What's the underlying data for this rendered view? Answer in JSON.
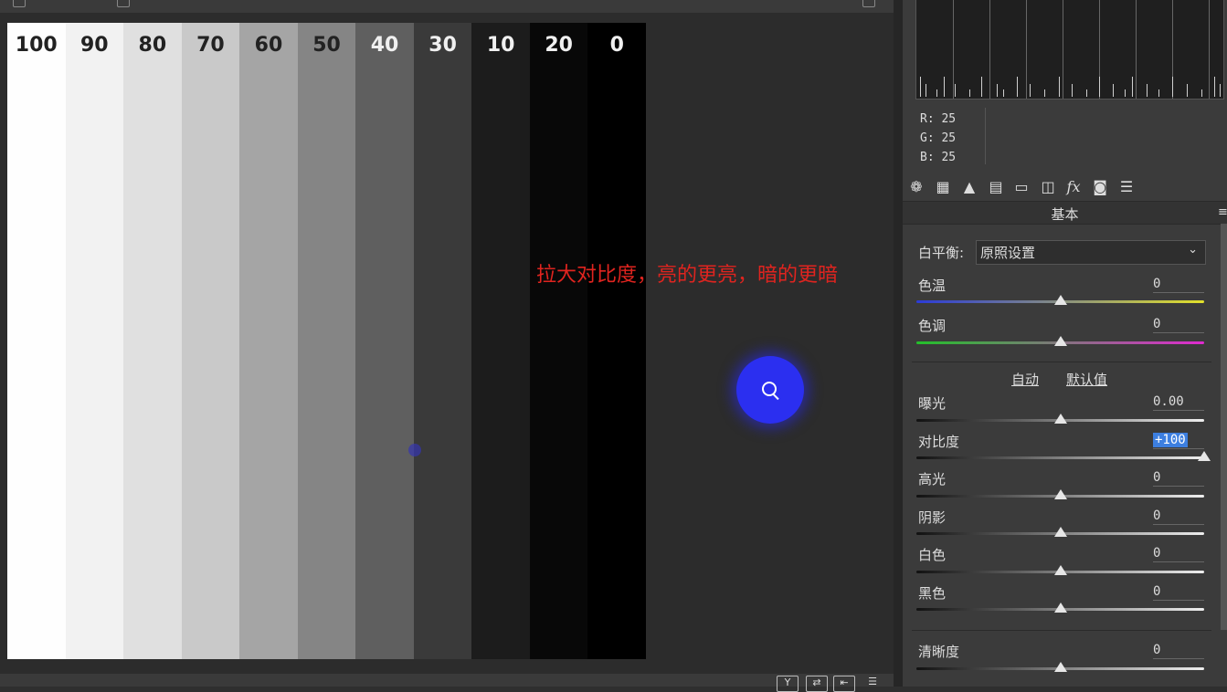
{
  "gray_strips": [
    {
      "label": "100",
      "bg": "#fefefe",
      "fg": "#222"
    },
    {
      "label": "90",
      "bg": "#f2f2f2",
      "fg": "#222"
    },
    {
      "label": "80",
      "bg": "#e0e0e0",
      "fg": "#222"
    },
    {
      "label": "70",
      "bg": "#c9c9c9",
      "fg": "#222"
    },
    {
      "label": "60",
      "bg": "#a5a5a5",
      "fg": "#222"
    },
    {
      "label": "50",
      "bg": "#858585",
      "fg": "#222"
    },
    {
      "label": "40",
      "bg": "#5f5f5f",
      "fg": "#f0f0f0"
    },
    {
      "label": "30",
      "bg": "#3a3a3a",
      "fg": "#f0f0f0"
    },
    {
      "label": "10",
      "bg": "#1c1c1c",
      "fg": "#f0f0f0"
    },
    {
      "label": "20",
      "bg": "#080808",
      "fg": "#f0f0f0"
    },
    {
      "label": "0",
      "bg": "#000000",
      "fg": "#f0f0f0"
    }
  ],
  "annotation": "拉大对比度，亮的更亮，暗的更暗",
  "readout": {
    "r": "R:  25",
    "g": "G:  25",
    "b": "B:  25"
  },
  "section_title": "基本",
  "white_balance": {
    "label": "白平衡:",
    "value": "原照设置"
  },
  "auto_label": "自动",
  "default_label": "默认值",
  "sliders": [
    {
      "key": "temp",
      "label": "色温",
      "value": "0",
      "level": 0.5
    },
    {
      "key": "tint",
      "label": "色调",
      "value": "0",
      "level": 0.5
    },
    {
      "key": "exposure",
      "label": "曝光",
      "value": "0.00",
      "level": 0.5
    },
    {
      "key": "contrast",
      "label": "对比度",
      "value": "+100",
      "level": 1.0
    },
    {
      "key": "highlights",
      "label": "高光",
      "value": "0",
      "level": 0.5
    },
    {
      "key": "shadows",
      "label": "阴影",
      "value": "0",
      "level": 0.5
    },
    {
      "key": "whites",
      "label": "白色",
      "value": "0",
      "level": 0.5
    },
    {
      "key": "blacks",
      "label": "黑色",
      "value": "0",
      "level": 0.5
    },
    {
      "key": "clarity",
      "label": "清晰度",
      "value": "0",
      "level": 0.5
    }
  ],
  "tool_icons": [
    "aperture-icon",
    "grid-icon",
    "mountain-icon",
    "split-icon",
    "hsl-icon",
    "lens-icon",
    "fx-icon",
    "camera-icon",
    "sliders-icon"
  ],
  "colors": {
    "annotation": "#e0241f",
    "cursor": "#2b2ff0",
    "highlight": "#3d7fe0"
  }
}
